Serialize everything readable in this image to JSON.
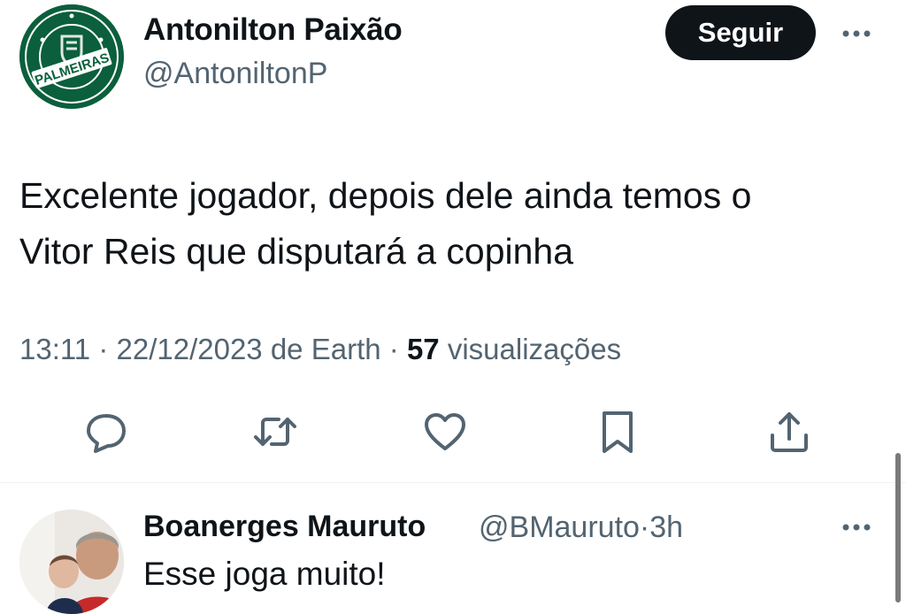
{
  "tweet": {
    "author": {
      "name": "Antonilton Paixão",
      "handle": "@AntoniltonP",
      "avatar_icon": "palmeiras-crest-avatar"
    },
    "follow_label": "Seguir",
    "text_lines": [
      "Excelente jogador, depois dele ainda temos o",
      "Vitor Reis que disputará a copinha"
    ],
    "meta": {
      "time": "13:11",
      "date": "22/12/2023",
      "source_prefix": "de",
      "source": "Earth",
      "views_count": "57",
      "views_label": "visualizações"
    },
    "actions": [
      "reply-icon",
      "retweet-icon",
      "like-icon",
      "bookmark-icon",
      "share-icon"
    ],
    "colors": {
      "text": "#0f1419",
      "muted": "#536471",
      "button": "#0f1419",
      "divider": "#eff3f4"
    }
  },
  "reply": {
    "name": "Boanerges Mauruto",
    "handle": "@BMauruto",
    "time": "3h",
    "text": "Esse joga muito!"
  }
}
